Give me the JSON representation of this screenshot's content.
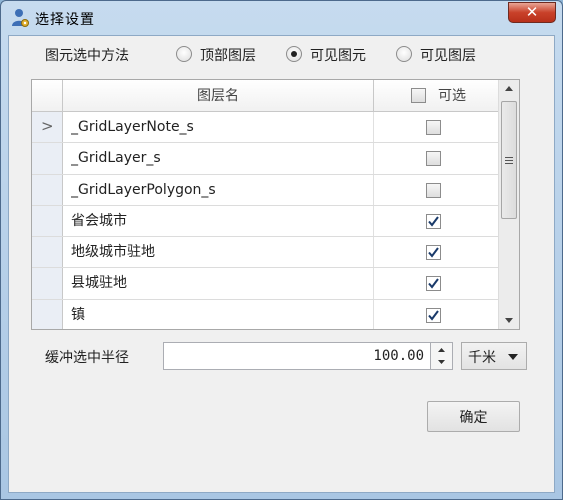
{
  "window": {
    "title": "选择设置",
    "close_label": "✕"
  },
  "selection_method": {
    "label": "图元选中方法",
    "options": [
      {
        "label": "顶部图层",
        "checked": false
      },
      {
        "label": "可见图元",
        "checked": true
      },
      {
        "label": "可见图层",
        "checked": false
      }
    ]
  },
  "layers_table": {
    "columns": {
      "name": "图层名",
      "visible": "可选"
    },
    "header_checkbox_checked": false,
    "current_row": 0,
    "rows": [
      {
        "name": "_GridLayerNote_s",
        "selectable": false
      },
      {
        "name": "_GridLayer_s",
        "selectable": false
      },
      {
        "name": "_GridLayerPolygon_s",
        "selectable": false
      },
      {
        "name": "省会城市",
        "selectable": true
      },
      {
        "name": "地级城市驻地",
        "selectable": true
      },
      {
        "name": "县城驻地",
        "selectable": true
      },
      {
        "name": "镇",
        "selectable": true
      }
    ]
  },
  "buffer_radius": {
    "label": "缓冲选中半径",
    "value": "100.00",
    "unit": "千米"
  },
  "buttons": {
    "ok_label": "确定"
  }
}
